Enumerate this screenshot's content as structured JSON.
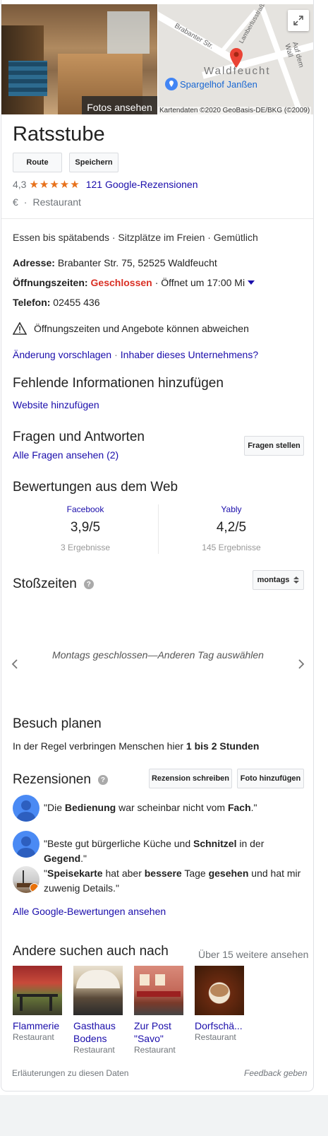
{
  "header": {
    "photos_label": "Fotos ansehen",
    "map_attribution": "Kartendaten ©2020 GeoBasis-DE/BKG (©2009)",
    "map_poi": "Spargelhof Janßen",
    "map_town": "Waldfeucht",
    "map_streets": [
      "Brabanter Str.",
      "Lambertusstraße",
      "Auf dem Wall"
    ]
  },
  "business": {
    "name": "Ratsstube",
    "buttons": {
      "route": "Route",
      "save": "Speichern"
    },
    "rating": "4,3",
    "stars": "★★★★★",
    "reviews_link": "121 Google-Rezensionen",
    "price": "€",
    "sep": "·",
    "category": "Restaurant"
  },
  "highlights": "Essen bis spätabends · Sitzplätze im Freien · Gemütlich",
  "details": {
    "address_label": "Adresse:",
    "address": "Brabanter Str. 75, 52525 Waldfeucht",
    "hours_label": "Öffnungszeiten:",
    "hours_status": "Geschlossen",
    "hours_next": "· Öffnet um 17:00 Mi",
    "phone_label": "Telefon:",
    "phone": "02455 436",
    "warning": "Öffnungszeiten und Angebote können abweichen",
    "suggest_edit": "Änderung vorschlagen",
    "sep": "·",
    "owner": "Inhaber dieses Unternehmens?"
  },
  "missing_info": {
    "title": "Fehlende Informationen hinzufügen",
    "add_website": "Website hinzufügen"
  },
  "qa": {
    "title": "Fragen und Antworten",
    "all_link": "Alle Fragen ansehen (2)",
    "ask_button": "Fragen stellen"
  },
  "web_reviews": {
    "title": "Bewertungen aus dem Web",
    "sources": [
      {
        "name": "Facebook",
        "score": "3,9/5",
        "count": "3 Ergebnisse"
      },
      {
        "name": "Yably",
        "score": "4,2/5",
        "count": "145 Ergebnisse"
      }
    ]
  },
  "popular_times": {
    "title": "Stoßzeiten",
    "day_select": "montags",
    "closed_msg": "Montags geschlossen—Anderen Tag auswählen"
  },
  "plan_visit": {
    "title": "Besuch planen",
    "text_prefix": "In der Regel verbringen Menschen hier ",
    "text_bold": "1 bis 2 Stunden"
  },
  "reviews": {
    "title": "Rezensionen",
    "write_button": "Rezension schreiben",
    "photo_button": "Foto hinzufügen",
    "items": [
      {
        "parts": [
          "\"Die ",
          "Bedienung",
          " war scheinbar nicht vom ",
          "Fach",
          ".\""
        ]
      },
      {
        "parts": [
          "\"Beste gut bürgerliche Küche und ",
          "Schnitzel",
          " in der ",
          "Gegend",
          ".\""
        ]
      },
      {
        "parts": [
          "\"",
          "Speisekarte",
          " hat aber ",
          "bessere",
          " Tage ",
          "gesehen",
          " und hat mir zuwenig Details.\""
        ]
      }
    ],
    "all_link": "Alle Google-Bewertungen ansehen"
  },
  "also_search": {
    "title": "Andere suchen auch nach",
    "more_link": "Über 15 weitere ansehen",
    "items": [
      {
        "name": "Flammerie",
        "type": "Restaurant"
      },
      {
        "name": "Gasthaus Bodens",
        "type": "Restaurant"
      },
      {
        "name": "Zur Post \"Savo\"",
        "type": "Restaurant"
      },
      {
        "name": "Dorfschä...",
        "type": "Restaurant"
      }
    ]
  },
  "footer": {
    "explain": "Erläuterungen zu diesen Daten",
    "feedback": "Feedback geben"
  }
}
